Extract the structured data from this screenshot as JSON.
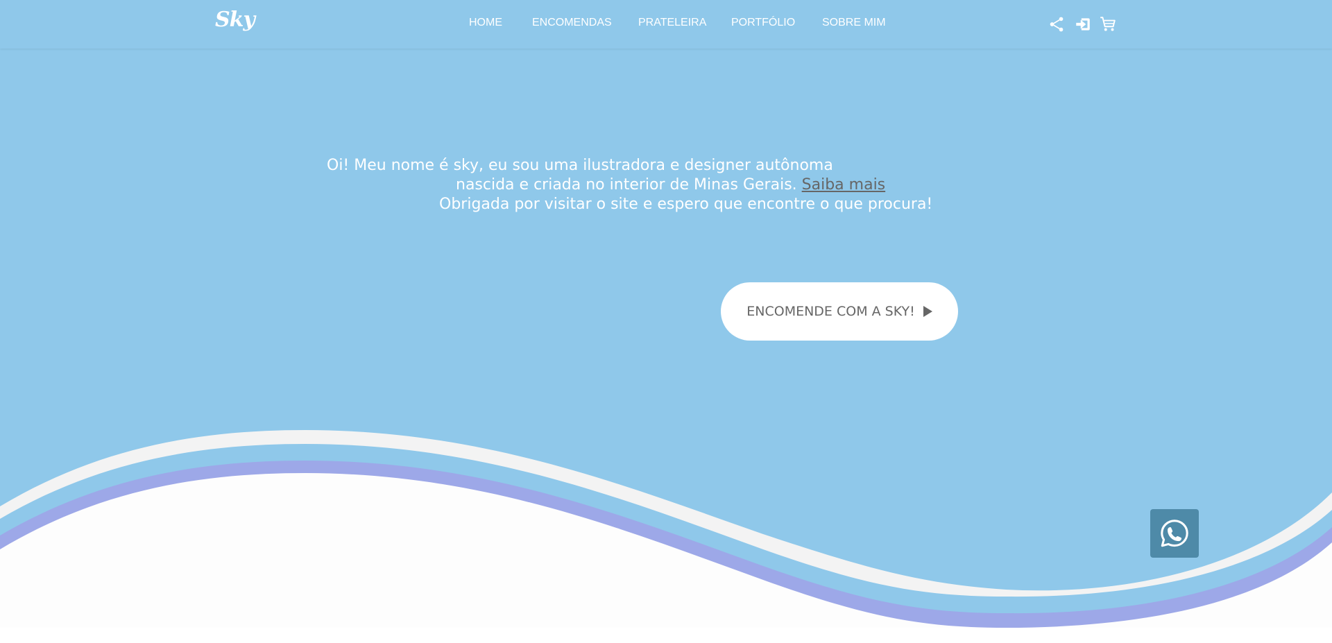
{
  "brand": {
    "logo_text": "Sky"
  },
  "nav": {
    "items": [
      {
        "label": "HOME"
      },
      {
        "label": "ENCOMENDAS"
      },
      {
        "label": "PRATELEIRA"
      },
      {
        "label": "PORTFÓLIO"
      },
      {
        "label": "SOBRE MIM"
      }
    ]
  },
  "header_icons": {
    "share": "share-icon",
    "login": "login-icon",
    "cart": "cart-icon"
  },
  "intro": {
    "line1": "Oi! Meu nome é sky, eu sou uma ilustradora e designer autônoma",
    "line2": "nascida e criada no interior de Minas Gerais.",
    "link": "Saiba mais",
    "line3": "Obrigada por visitar o site e espero que encontre o que procura!"
  },
  "cta": {
    "label": "ENCOMENDE COM A SKY!"
  },
  "floating": {
    "whatsapp_icon": "whatsapp-icon"
  },
  "colors": {
    "hero_blue": "#8fc8ea",
    "wave_white": "#f3f3f3",
    "wave_purple": "#9da8e8",
    "link_gray": "#666666",
    "whatsapp_bg": "#4e8aa8"
  }
}
